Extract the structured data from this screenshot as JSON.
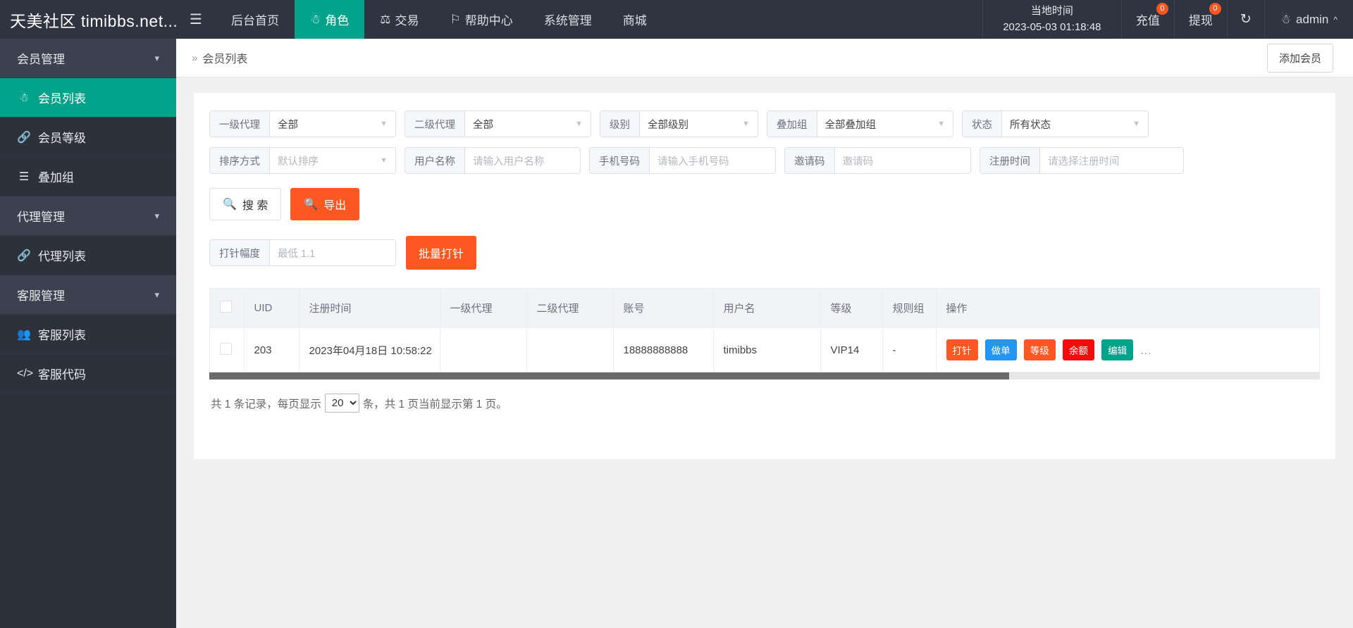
{
  "topbar": {
    "brand": "天美社区 timibbs.net...",
    "hamburger_icon": "menu-icon",
    "nav": [
      {
        "label": "后台首页",
        "icon": "",
        "active": false
      },
      {
        "label": "角色",
        "icon": "user-icon",
        "active": true
      },
      {
        "label": "交易",
        "icon": "scales-icon",
        "active": false
      },
      {
        "label": "帮助中心",
        "icon": "flag-icon",
        "active": false
      },
      {
        "label": "系统管理",
        "icon": "",
        "active": false
      },
      {
        "label": "商城",
        "icon": "",
        "active": false
      }
    ],
    "localtime_label": "当地时间",
    "localtime_value": "2023-05-03 01:18:48",
    "recharge_label": "充值",
    "recharge_badge": "0",
    "withdraw_label": "提现",
    "withdraw_badge": "0",
    "refresh_icon": "refresh-icon",
    "user_label": "admin",
    "user_icon": "user-icon",
    "user_caret": "chevron-up-icon",
    "accent_color": "#00a28a",
    "badge_color": "#ff5722"
  },
  "sidebar": {
    "groups": [
      {
        "label": "会员管理",
        "caret": "chevron-down-icon"
      },
      {
        "label": "代理管理",
        "caret": "chevron-down-icon"
      },
      {
        "label": "客服管理",
        "caret": "chevron-down-icon"
      }
    ],
    "items": [
      {
        "label": "会员列表",
        "icon": "user-icon",
        "active": true
      },
      {
        "label": "会员等级",
        "icon": "link-icon",
        "active": false
      },
      {
        "label": "叠加组",
        "icon": "list-icon",
        "active": false
      },
      {
        "label": "代理列表",
        "icon": "link-icon",
        "active": false
      },
      {
        "label": "客服列表",
        "icon": "users-icon",
        "active": false
      },
      {
        "label": "客服代码",
        "icon": "code-icon",
        "active": false
      }
    ]
  },
  "breadcrumb": {
    "arrows": "»",
    "title": "会员列表",
    "add_member_label": "添加会员"
  },
  "filters": {
    "row1": [
      {
        "label": "一级代理",
        "value": "全部",
        "type": "select",
        "placeholder": false
      },
      {
        "label": "二级代理",
        "value": "全部",
        "type": "select",
        "placeholder": false
      },
      {
        "label": "级别",
        "value": "全部级别",
        "type": "select",
        "placeholder": false
      },
      {
        "label": "叠加组",
        "value": "全部叠加组",
        "type": "select",
        "placeholder": false
      },
      {
        "label": "状态",
        "value": "所有状态",
        "type": "select",
        "placeholder": false
      }
    ],
    "row2": [
      {
        "label": "排序方式",
        "value": "默认排序",
        "type": "select",
        "placeholder": true
      },
      {
        "label": "用户名称",
        "value": "请输入用户名称",
        "type": "input",
        "placeholder": true
      },
      {
        "label": "手机号码",
        "value": "请输入手机号码",
        "type": "input",
        "placeholder": true
      },
      {
        "label": "邀请码",
        "value": "邀请码",
        "type": "input",
        "placeholder": true
      },
      {
        "label": "注册时间",
        "value": "请选择注册时间",
        "type": "input",
        "placeholder": true
      }
    ],
    "search_label": "搜 索",
    "search_icon": "search-icon",
    "export_label": "导出",
    "export_icon": "search-icon",
    "inject_label": "打针幅度",
    "inject_placeholder": "最低 1.1",
    "batch_inject_label": "批量打针"
  },
  "table": {
    "columns": [
      "UID",
      "注册时间",
      "一级代理",
      "二级代理",
      "账号",
      "用户名",
      "等级",
      "规则组",
      "操作"
    ],
    "rows": [
      {
        "uid": "203",
        "reg_time": "2023年04月18日 10:58:22",
        "agent1": "",
        "agent2": "",
        "account": "18888888888",
        "username": "timibbs",
        "level": "VIP14",
        "rule_group": "-",
        "actions": [
          {
            "label": "打针",
            "color": "t-orange"
          },
          {
            "label": "做单",
            "color": "t-blue"
          },
          {
            "label": "等级",
            "color": "t-orange"
          },
          {
            "label": "余额",
            "color": "t-red"
          },
          {
            "label": "编辑",
            "color": "t-green"
          }
        ],
        "more_label": "..."
      }
    ]
  },
  "footer": {
    "prefix": "共 1 条记录，每页显示",
    "page_size": "20",
    "page_size_options": [
      "20"
    ],
    "suffix": "条，共 1 页当前显示第 1 页。"
  }
}
